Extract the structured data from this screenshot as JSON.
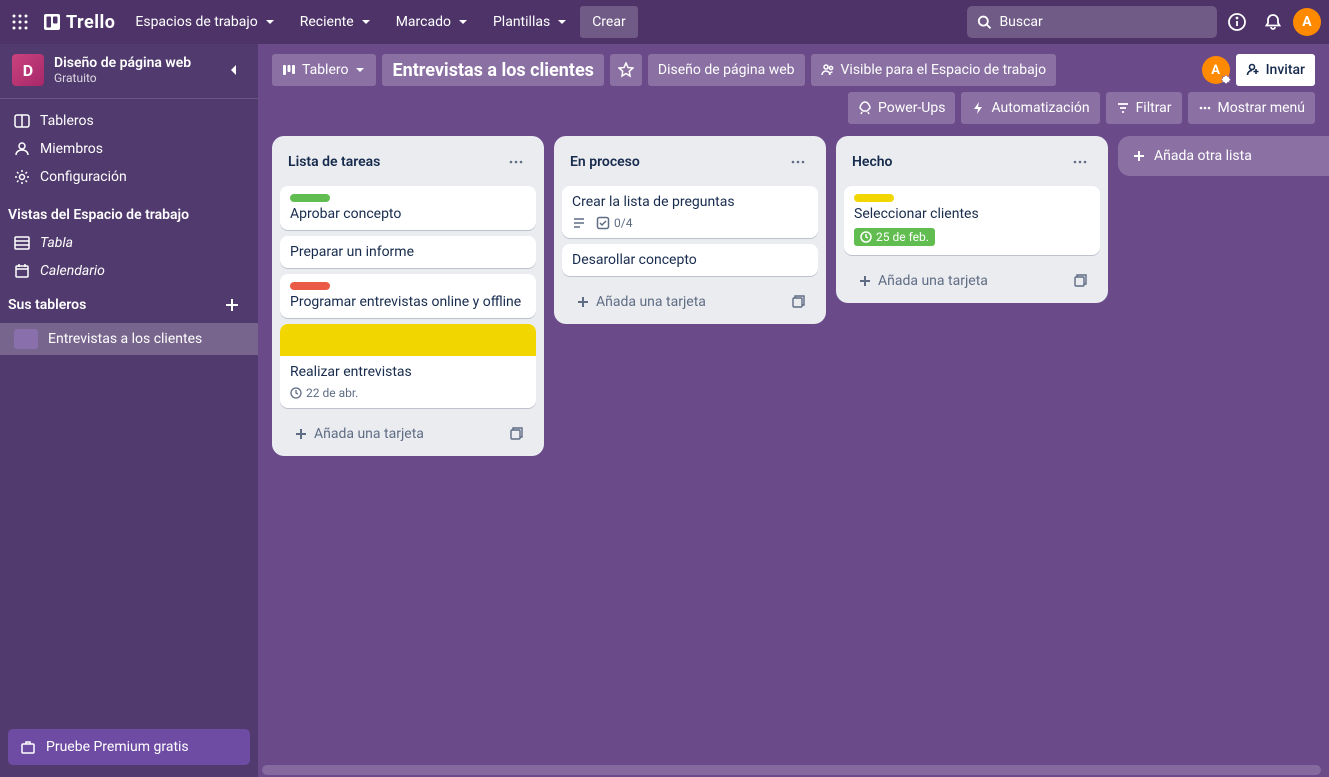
{
  "header": {
    "logo": "Trello",
    "nav": {
      "workspaces": "Espacios de trabajo",
      "recent": "Reciente",
      "starred": "Marcado",
      "templates": "Plantillas",
      "create": "Crear"
    },
    "search_placeholder": "Buscar",
    "avatar_initial": "A"
  },
  "sidebar": {
    "workspace": {
      "initial": "D",
      "name": "Diseño de página web",
      "plan": "Gratuito"
    },
    "nav": {
      "boards": "Tableros",
      "members": "Miembros",
      "settings": "Configuración"
    },
    "views_heading": "Vistas del Espacio de trabajo",
    "views": {
      "table": "Tabla",
      "calendar": "Calendario"
    },
    "your_boards_heading": "Sus tableros",
    "boards": [
      {
        "name": "Entrevistas a los clientes"
      }
    ],
    "premium_cta": "Pruebe Premium gratis"
  },
  "board_header": {
    "view_label": "Tablero",
    "title": "Entrevistas a los clientes",
    "workspace_link": "Diseño de página web",
    "visibility": "Visible para el Espacio de trabajo",
    "avatar_initial": "A",
    "invite": "Invitar",
    "powerups": "Power-Ups",
    "automation": "Automatización",
    "filter": "Filtrar",
    "show_menu": "Mostrar menú"
  },
  "lists": [
    {
      "title": "Lista de tareas",
      "cards": [
        {
          "label": "green",
          "title": "Aprobar concepto"
        },
        {
          "title": "Preparar un informe"
        },
        {
          "label": "red",
          "title": "Programar entrevistas online y offline"
        },
        {
          "cover": "yellow",
          "title": "Realizar entrevistas",
          "due": "22 de abr."
        }
      ],
      "add_card": "Añada una tarjeta"
    },
    {
      "title": "En proceso",
      "cards": [
        {
          "title": "Crear la lista de preguntas",
          "desc": true,
          "checklist": "0/4"
        },
        {
          "title": "Desarollar concepto"
        }
      ],
      "add_card": "Añada una tarjeta"
    },
    {
      "title": "Hecho",
      "cards": [
        {
          "label": "yellow",
          "title": "Seleccionar clientes",
          "due_done": "25 de feb."
        }
      ],
      "add_card": "Añada una tarjeta"
    }
  ],
  "add_list": "Añada otra lista"
}
